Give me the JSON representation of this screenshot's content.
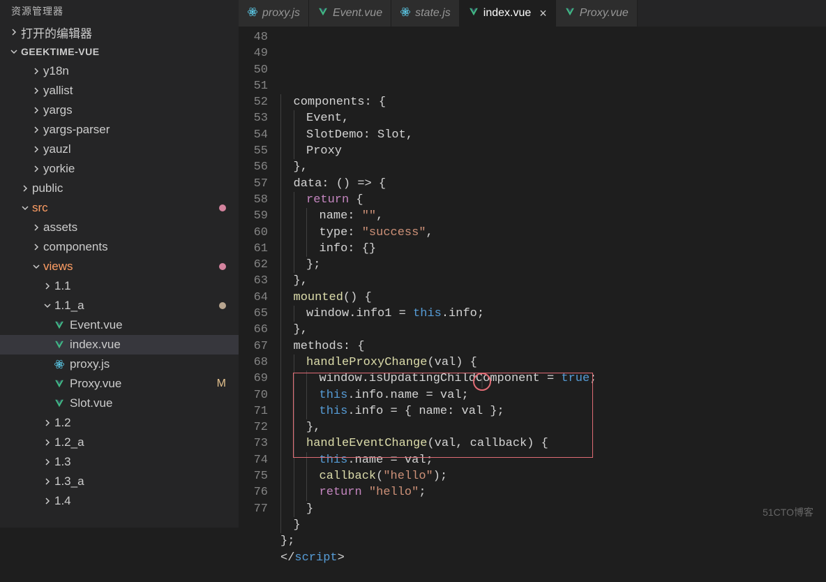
{
  "sidebar": {
    "title": "资源管理器",
    "openEditors": "打开的编辑器",
    "project": "GEEKTIME-VUE",
    "items": [
      {
        "label": "y18n",
        "type": "folder",
        "indent": 2
      },
      {
        "label": "yallist",
        "type": "folder",
        "indent": 2
      },
      {
        "label": "yargs",
        "type": "folder",
        "indent": 2
      },
      {
        "label": "yargs-parser",
        "type": "folder",
        "indent": 2
      },
      {
        "label": "yauzl",
        "type": "folder",
        "indent": 2
      },
      {
        "label": "yorkie",
        "type": "folder",
        "indent": 2
      },
      {
        "label": "public",
        "type": "folder",
        "indent": 1
      },
      {
        "label": "src",
        "type": "folder",
        "indent": 1,
        "expanded": true,
        "highlight": "src",
        "dot": "pink"
      },
      {
        "label": "assets",
        "type": "folder",
        "indent": 2
      },
      {
        "label": "components",
        "type": "folder",
        "indent": 2
      },
      {
        "label": "views",
        "type": "folder",
        "indent": 2,
        "expanded": true,
        "highlight": "views",
        "dot": "pink"
      },
      {
        "label": "1.1",
        "type": "folder",
        "indent": 3
      },
      {
        "label": "1.1_a",
        "type": "folder",
        "indent": 3,
        "expanded": true,
        "dot": "tan"
      },
      {
        "label": "Event.vue",
        "type": "vue",
        "indent": 4
      },
      {
        "label": "index.vue",
        "type": "vue",
        "indent": 4,
        "selected": true
      },
      {
        "label": "proxy.js",
        "type": "js",
        "indent": 4
      },
      {
        "label": "Proxy.vue",
        "type": "vue",
        "indent": 4,
        "status": "M"
      },
      {
        "label": "Slot.vue",
        "type": "vue",
        "indent": 4
      },
      {
        "label": "1.2",
        "type": "folder",
        "indent": 3
      },
      {
        "label": "1.2_a",
        "type": "folder",
        "indent": 3
      },
      {
        "label": "1.3",
        "type": "folder",
        "indent": 3
      },
      {
        "label": "1.3_a",
        "type": "folder",
        "indent": 3
      },
      {
        "label": "1.4",
        "type": "folder",
        "indent": 3
      }
    ]
  },
  "tabs": [
    {
      "label": "proxy.js",
      "icon": "js",
      "active": false
    },
    {
      "label": "Event.vue",
      "icon": "vue",
      "active": false
    },
    {
      "label": "state.js",
      "icon": "js",
      "active": false
    },
    {
      "label": "index.vue",
      "icon": "vue",
      "active": true,
      "close": "×"
    },
    {
      "label": "Proxy.vue",
      "icon": "vue",
      "active": false
    }
  ],
  "code": {
    "startLine": 48,
    "endLine": 77,
    "lines": [
      {
        "n": 48,
        "html": "  components: {"
      },
      {
        "n": 49,
        "html": "    Event,"
      },
      {
        "n": 50,
        "html": "    SlotDemo: Slot,"
      },
      {
        "n": 51,
        "html": "    Proxy"
      },
      {
        "n": 52,
        "html": "  },"
      },
      {
        "n": 53,
        "html": "  data: () => {"
      },
      {
        "n": 54,
        "html": "    <span class='kw'>return</span> {"
      },
      {
        "n": 55,
        "html": "      name: <span class='str'>\"\"</span>,"
      },
      {
        "n": 56,
        "html": "      type: <span class='str'>\"success\"</span>,"
      },
      {
        "n": 57,
        "html": "      info: {}"
      },
      {
        "n": 58,
        "html": "    };"
      },
      {
        "n": 59,
        "html": "  },"
      },
      {
        "n": 60,
        "html": "  <span class='fn'>mounted</span>() {"
      },
      {
        "n": 61,
        "html": "    window.info1 = <span class='this'>this</span>.info;"
      },
      {
        "n": 62,
        "html": "  },"
      },
      {
        "n": 63,
        "html": "  methods: {"
      },
      {
        "n": 64,
        "html": "    <span class='fn'>handleProxyChange</span>(val) {"
      },
      {
        "n": 65,
        "html": "      window.isUpdatingChildComponent = <span class='bool'>true</span>;"
      },
      {
        "n": 66,
        "html": "      <span class='this'>this</span>.info.name = val;"
      },
      {
        "n": 67,
        "html": "      <span class='this'>this</span>.info = { name: val };"
      },
      {
        "n": 68,
        "html": "    },"
      },
      {
        "n": 69,
        "html": "    <span class='fn'>handleEventChange</span>(val, callback) {"
      },
      {
        "n": 70,
        "html": "      <span class='this'>this</span>.name = val;"
      },
      {
        "n": 71,
        "html": "      <span class='fn'>callback</span>(<span class='str'>\"hello\"</span>);"
      },
      {
        "n": 72,
        "html": "      <span class='kw'>return</span> <span class='str'>\"hello\"</span>;"
      },
      {
        "n": 73,
        "html": "    }"
      },
      {
        "n": 74,
        "html": "  }"
      },
      {
        "n": 75,
        "html": "};"
      },
      {
        "n": 76,
        "html": "&lt;/<span class='tag'>script</span>&gt;"
      },
      {
        "n": 77,
        "html": ""
      }
    ]
  },
  "watermark": "51CTO博客"
}
